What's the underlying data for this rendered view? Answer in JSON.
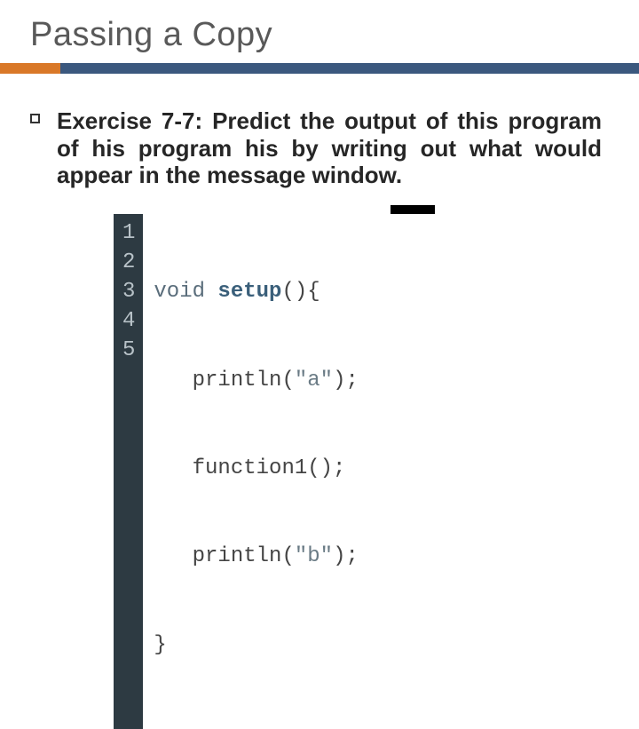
{
  "title": "Passing a Copy",
  "body": "Exercise 7-7: Predict the output of this program of his program his by writing out what would appear in the message window.",
  "code": {
    "lines": [
      "1",
      "2",
      "3",
      "4",
      "5"
    ],
    "l1_kw": "void",
    "l1_fn": "setup",
    "l1_rest": "(){",
    "l2_fn": "println",
    "l2_open": "(",
    "l2_str": "\"a\"",
    "l2_close": ");",
    "l3_fn": "function1",
    "l3_rest": "();",
    "l4_fn": "println",
    "l4_open": "(",
    "l4_str": "\"b\"",
    "l4_close": ");",
    "l5": "}"
  }
}
